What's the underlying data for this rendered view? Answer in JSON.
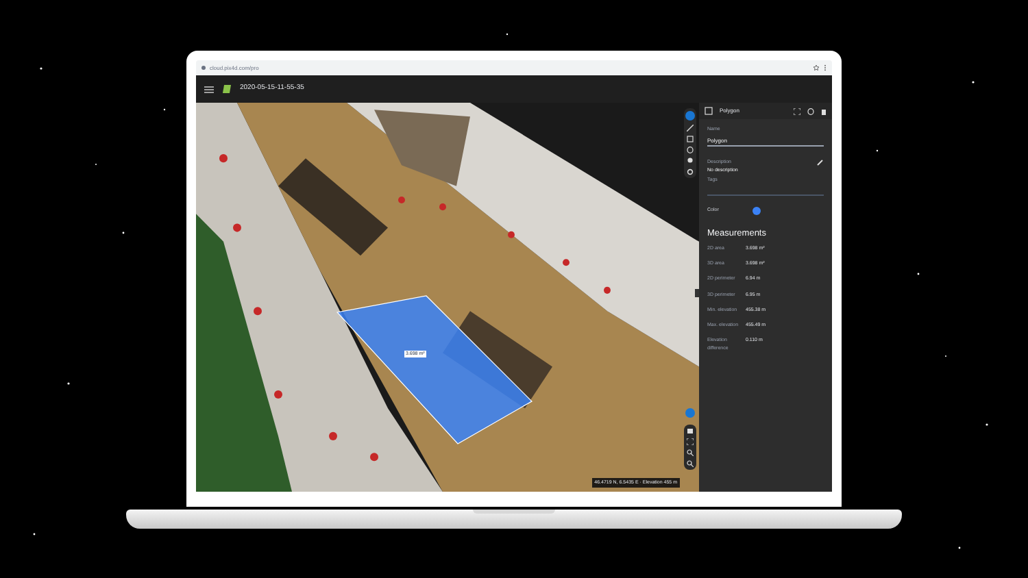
{
  "browser": {
    "url": "cloud.pix4d.com/pro"
  },
  "app_header": {
    "title": "2020-05-15-11-55-35"
  },
  "viewport": {
    "polygon_label": "3.698 m²",
    "status": "46.4719 N, 6.5435 E · Elevation 455 m"
  },
  "panel": {
    "title": "Polygon",
    "name_label": "Name",
    "name_value": "Polygon",
    "description_label": "Description",
    "description_value": "No description",
    "tags_label": "Tags",
    "color_label": "Color",
    "color": "#3b82f6",
    "measurements_title": "Measurements",
    "measurements": [
      {
        "label": "2D area",
        "value": "3.698 m²"
      },
      {
        "label": "3D area",
        "value": "3.698 m²"
      },
      {
        "label": "2D perimeter",
        "value": "6.94 m"
      },
      {
        "label": "3D perimeter",
        "value": "6.95 m"
      },
      {
        "label": "Min. elevation",
        "value": "455.38 m"
      },
      {
        "label": "Max. elevation",
        "value": "455.49 m"
      },
      {
        "label": "Elevation difference",
        "value": "0.110 m"
      }
    ]
  }
}
